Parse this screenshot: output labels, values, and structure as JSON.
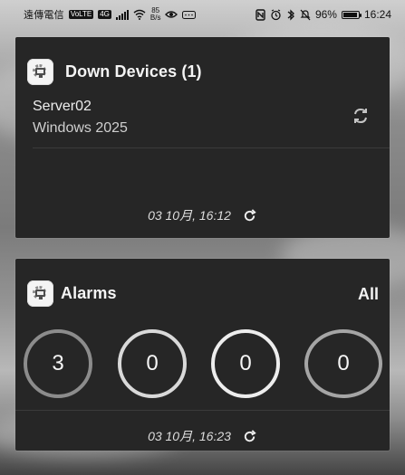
{
  "status_bar": {
    "carrier": "遠傳電信",
    "volte": "VoLTE",
    "network": "4G",
    "speed_top": "85",
    "speed_bottom": "B/s",
    "battery": "96%",
    "time": "16:24"
  },
  "devices_widget": {
    "title": "Down Devices (1)",
    "item": {
      "name": "Server02",
      "os": "Windows 2025"
    },
    "timestamp": "03 10月, 16:12"
  },
  "alarms_widget": {
    "title": "Alarms",
    "all_label": "All",
    "counts": [
      "3",
      "0",
      "0",
      "0"
    ],
    "timestamp": "03 10月, 16:23"
  },
  "icons": {
    "status_bar": [
      "nfc-icon",
      "alarm-icon",
      "bluetooth-icon",
      "mute-icon",
      "battery-icon"
    ],
    "device": "sync-icon",
    "timestamp": "refresh-icon",
    "app": "app-icon"
  },
  "colors": {
    "widget_background": "#262626",
    "text_primary": "#f4f4f4",
    "text_secondary": "#cfcfcf",
    "gauge_gray": "#8c8c8c",
    "gauge_light": "#ededed"
  }
}
